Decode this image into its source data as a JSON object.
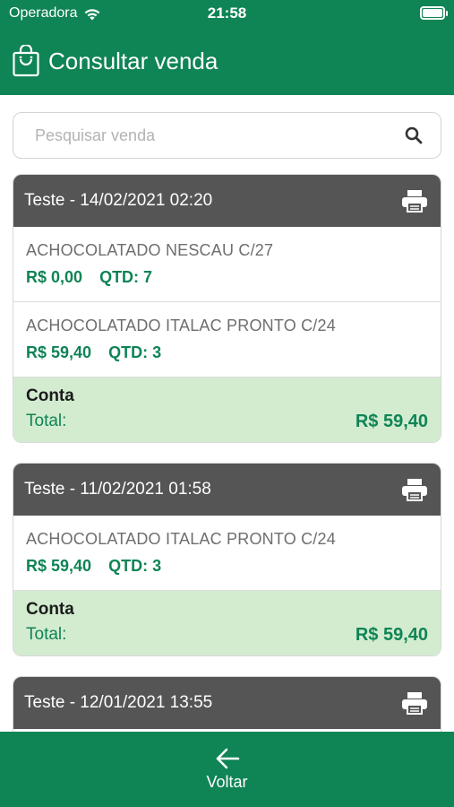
{
  "status_bar": {
    "carrier": "Operadora",
    "time": "21:58"
  },
  "nav": {
    "title": "Consultar venda",
    "icon": "shopping-bag-icon"
  },
  "search": {
    "placeholder": "Pesquisar venda",
    "icon": "search-icon"
  },
  "sales": [
    {
      "header": "Teste - 14/02/2021 02:20",
      "items": [
        {
          "name": "ACHOCOLATADO NESCAU C/27",
          "price": "R$ 0,00",
          "qty": "QTD: 7"
        },
        {
          "name": "ACHOCOLATADO ITALAC PRONTO C/24",
          "price": "R$ 59,40",
          "qty": "QTD: 3"
        }
      ],
      "account_label": "Conta",
      "total_label": "Total:",
      "total_value": "R$ 59,40"
    },
    {
      "header": "Teste - 11/02/2021 01:58",
      "items": [
        {
          "name": "ACHOCOLATADO ITALAC PRONTO C/24",
          "price": "R$ 59,40",
          "qty": "QTD: 3"
        }
      ],
      "account_label": "Conta",
      "total_label": "Total:",
      "total_value": "R$ 59,40"
    },
    {
      "header": "Teste - 12/01/2021 13:55",
      "items": [],
      "account_label": "",
      "total_label": "",
      "total_value": ""
    }
  ],
  "bottom": {
    "back_label": "Voltar",
    "icon": "arrow-left-icon"
  },
  "colors": {
    "brand_green": "#0f8455",
    "header_gray": "#555555",
    "total_bg": "#d3ecd0"
  }
}
